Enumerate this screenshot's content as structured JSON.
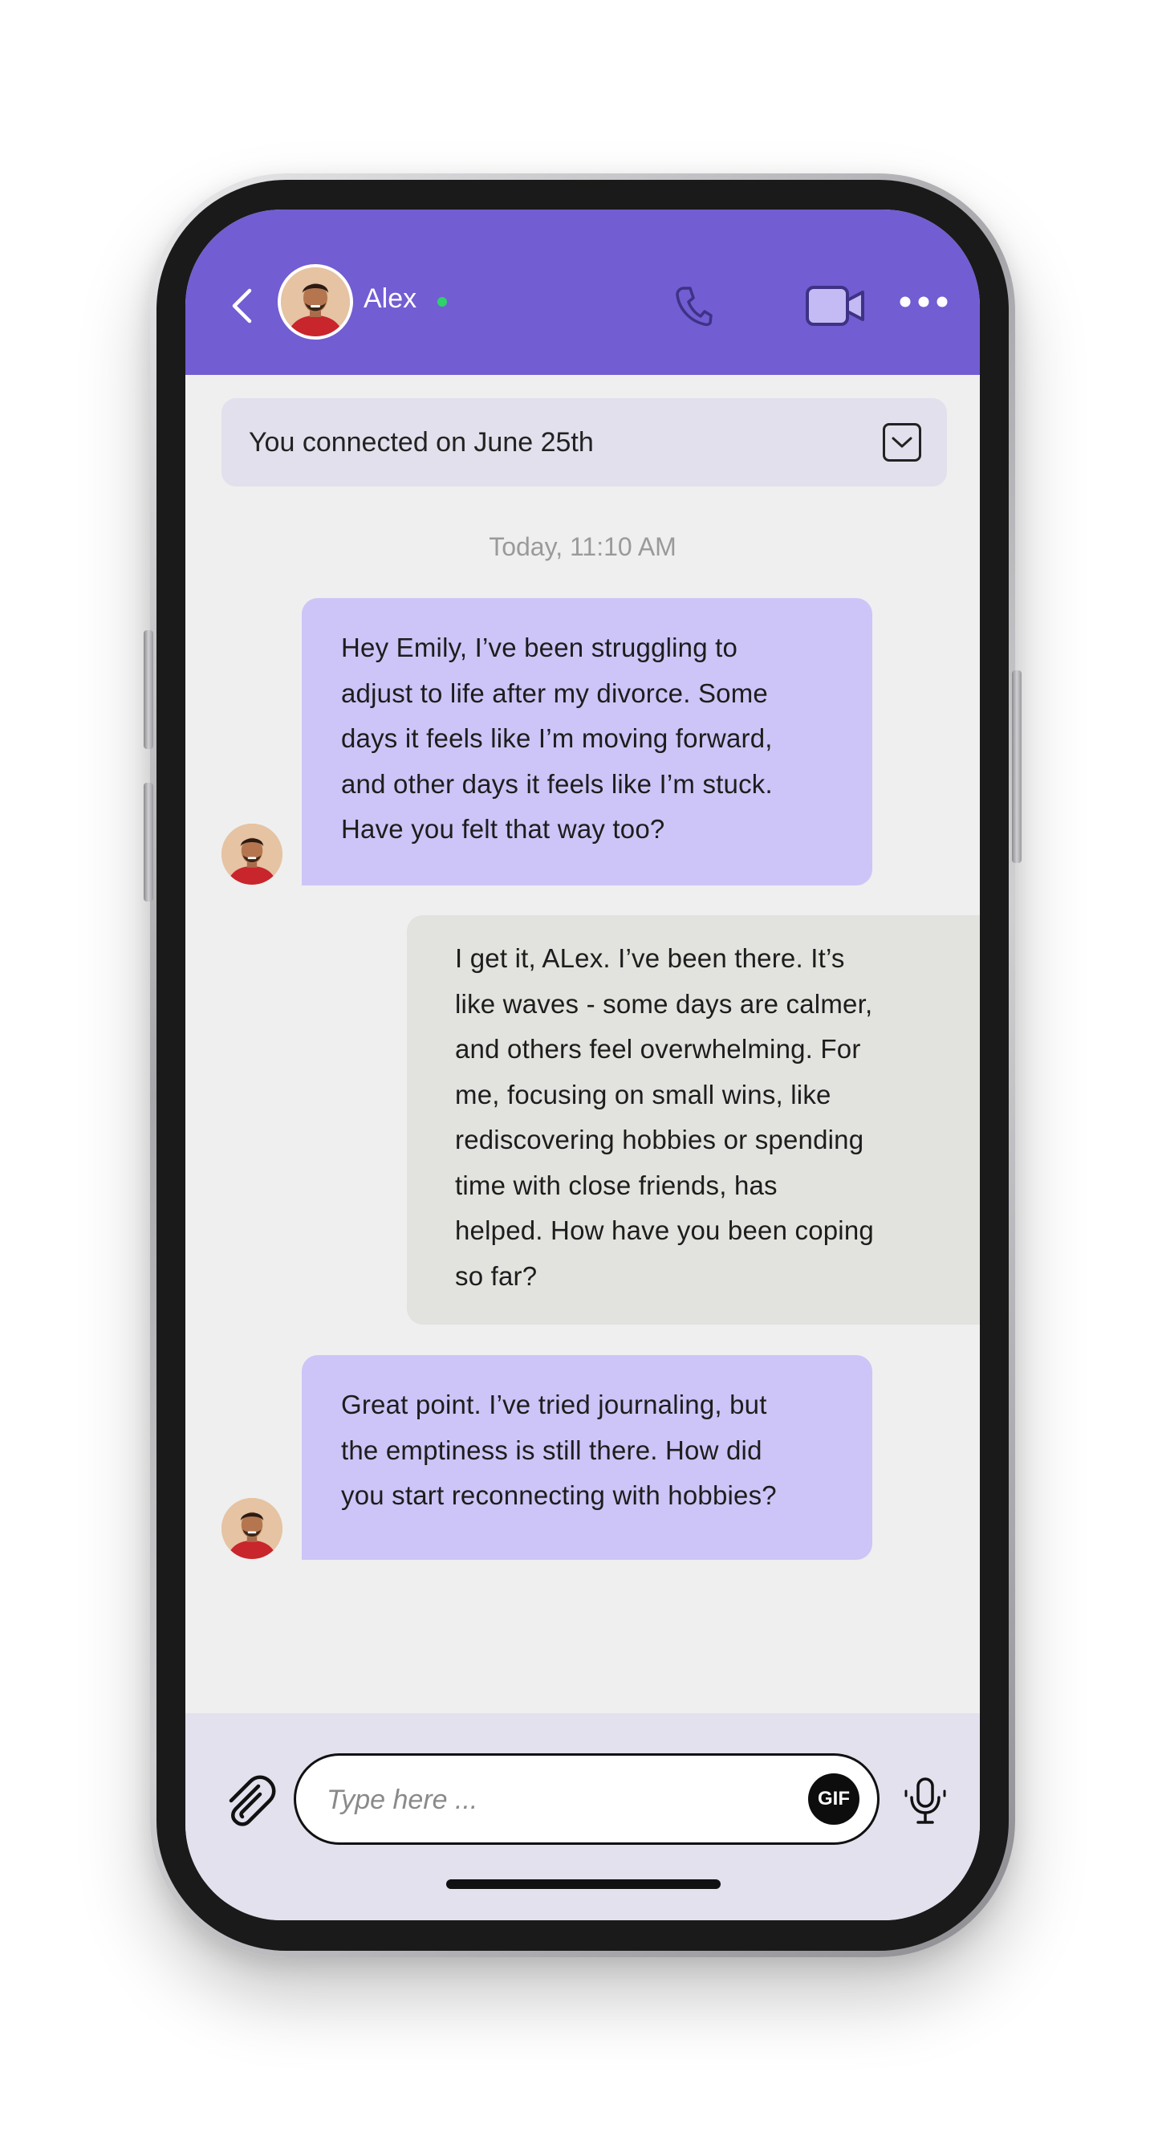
{
  "header": {
    "contact_name": "Alex",
    "online_status_color": "#2fd16b",
    "background_color": "#725dd2",
    "icons": {
      "back": "chevron-left-icon",
      "call": "phone-icon",
      "video": "video-camera-icon",
      "more": "more-horizontal-icon"
    }
  },
  "banner": {
    "text": "You connected on June 25th",
    "expand_icon": "chevron-down-icon"
  },
  "timestamp": "Today, 11:10 AM",
  "messages": [
    {
      "direction": "incoming",
      "sender": "Alex",
      "lines": [
        "Hey Emily, I’ve been struggling to",
        "adjust to life after my divorce. Some",
        "days it feels like I’m moving forward,",
        "and other days it feels like I’m stuck.",
        "Have you felt that way too?"
      ]
    },
    {
      "direction": "outgoing",
      "lines": [
        "I get it, ALex. I’ve been there. It’s",
        "like waves - some days are calmer,",
        "and others feel overwhelming. For",
        "me, focusing on small wins, like",
        "rediscovering hobbies or spending",
        "time with close friends, has",
        "helped. How have you been coping",
        "so far?"
      ]
    },
    {
      "direction": "incoming",
      "sender": "Alex",
      "lines": [
        "Great point. I’ve tried journaling, but",
        "the emptiness is still there. How did",
        "you start reconnecting with hobbies?"
      ]
    }
  ],
  "composer": {
    "placeholder": "Type here ...",
    "value": "",
    "gif_label": "GIF",
    "icons": {
      "attach": "paperclip-icon",
      "mic": "microphone-icon"
    }
  },
  "colors": {
    "incoming_bubble": "#cdc5f7",
    "outgoing_bubble": "#e2e2de",
    "chat_background": "#efefef",
    "composer_background": "#e3e1ed"
  }
}
